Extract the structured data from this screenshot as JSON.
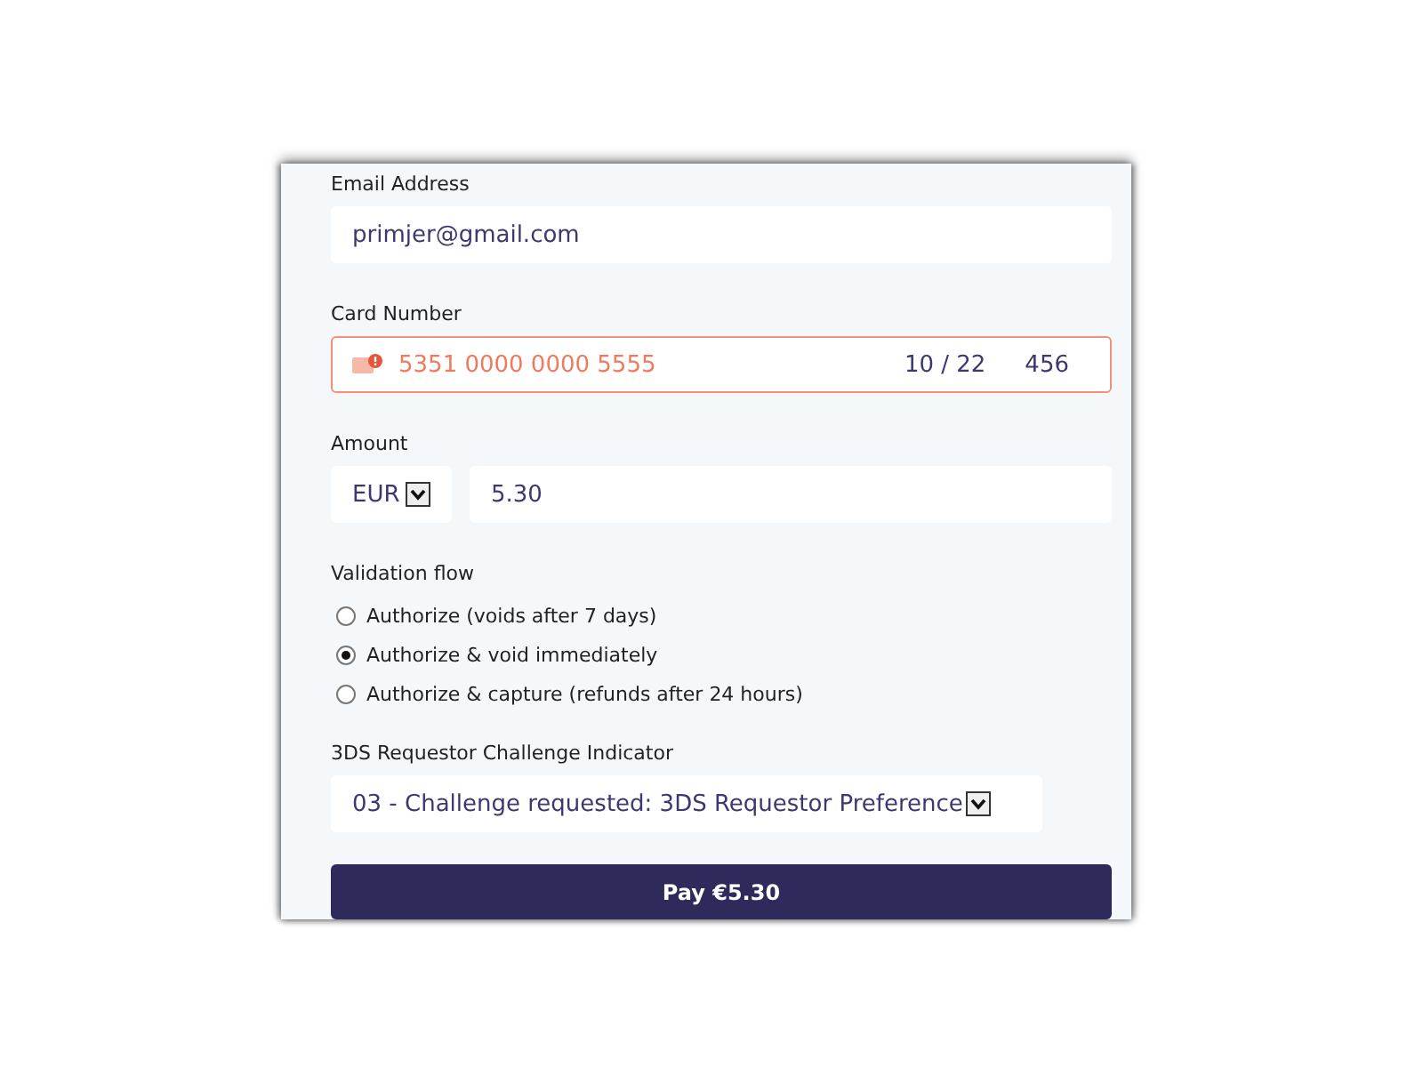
{
  "email": {
    "label": "Email Address",
    "value": "primjer@gmail.com"
  },
  "card": {
    "label": "Card Number",
    "number": "5351 0000 0000 5555",
    "expiry": "10 / 22",
    "cvc": "456",
    "error": true
  },
  "amount": {
    "label": "Amount",
    "currency": "EUR",
    "value": "5.30"
  },
  "validation": {
    "label": "Validation flow",
    "options": [
      {
        "label": "Authorize (voids after 7 days)",
        "selected": false
      },
      {
        "label": "Authorize & void immediately",
        "selected": true
      },
      {
        "label": "Authorize & capture (refunds after 24 hours)",
        "selected": false
      }
    ]
  },
  "challenge": {
    "label": "3DS Requestor Challenge Indicator",
    "value": "03 - Challenge requested: 3DS Requestor Preference"
  },
  "pay_button": "Pay €5.30"
}
